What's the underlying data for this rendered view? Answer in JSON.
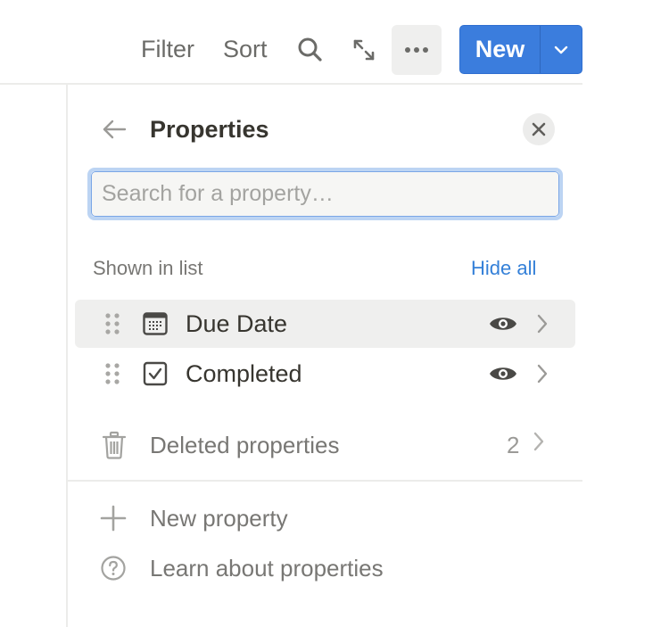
{
  "toolbar": {
    "filter_label": "Filter",
    "sort_label": "Sort",
    "search_icon": "search-icon",
    "expand_icon": "expand-arrows-icon",
    "more_icon": "more-horizontal-icon",
    "new_label": "New",
    "new_caret_icon": "chevron-down-icon",
    "accent_color": "#3b7ddd"
  },
  "panel": {
    "title": "Properties",
    "back_icon": "arrow-left-icon",
    "close_icon": "close-icon",
    "search": {
      "placeholder": "Search for a property…",
      "value": ""
    },
    "section_label": "Shown in list",
    "hide_all_label": "Hide all",
    "properties": [
      {
        "label": "Due Date",
        "type_icon": "calendar-icon",
        "visible": true,
        "highlighted": true
      },
      {
        "label": "Completed",
        "type_icon": "checkbox-icon",
        "visible": true,
        "highlighted": false
      }
    ],
    "deleted": {
      "label": "Deleted properties",
      "count": "2",
      "icon": "trash-icon"
    },
    "actions": [
      {
        "label": "New property",
        "icon": "plus-icon"
      },
      {
        "label": "Learn about properties",
        "icon": "help-circle-icon"
      }
    ]
  }
}
